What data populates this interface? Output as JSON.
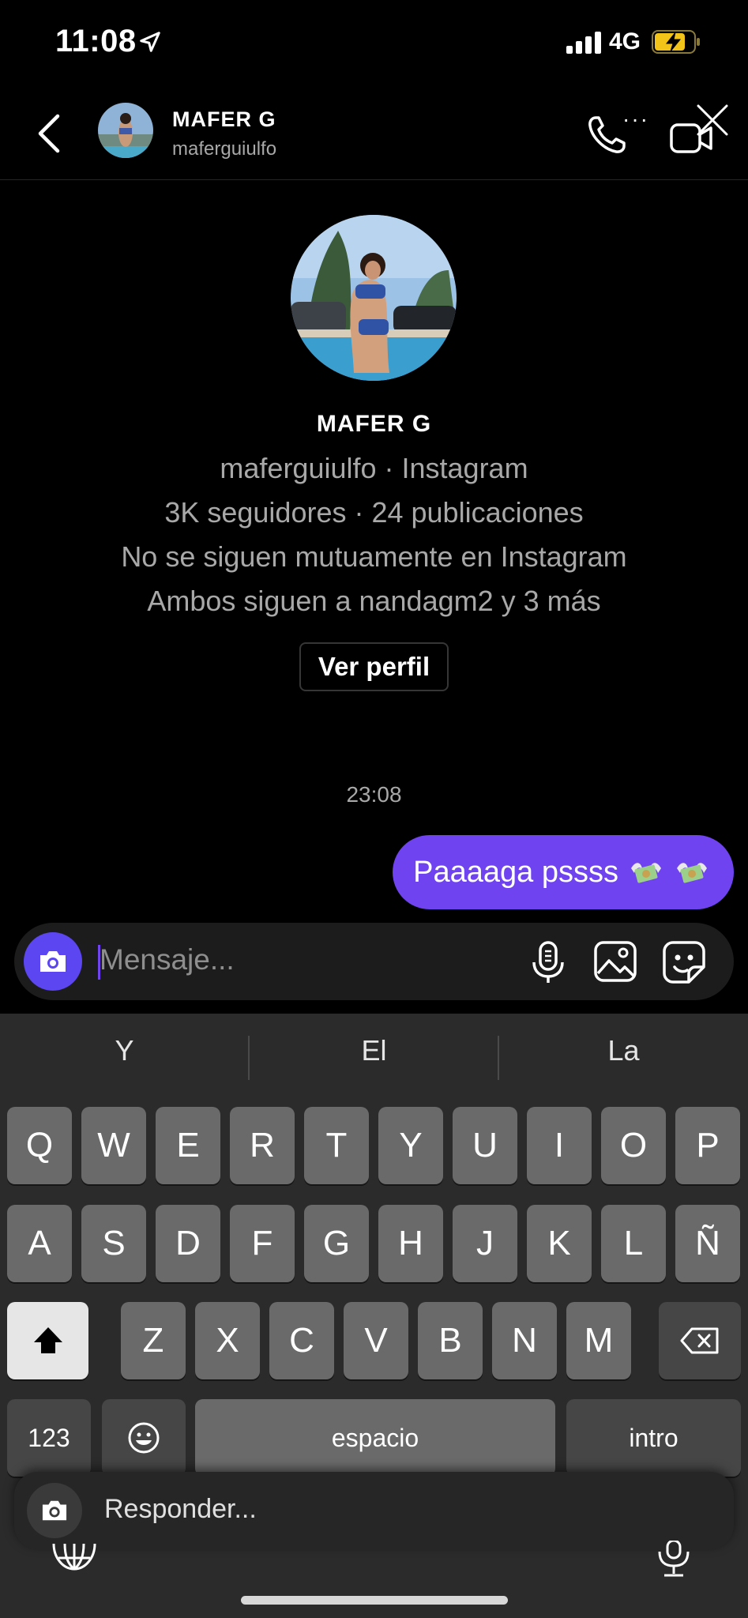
{
  "status_bar": {
    "time": "11:08",
    "network": "4G"
  },
  "header": {
    "name": "MAFER G",
    "username": "maferguiulfo",
    "more": "···"
  },
  "profile": {
    "name": "MAFER G",
    "line1": "maferguiulfo · Instagram",
    "line2": "3K seguidores · 24 publicaciones",
    "line3": "No se siguen mutuamente en Instagram",
    "line4": "Ambos siguen a nandagm2 y 3 más",
    "view_profile_label": "Ver perfil"
  },
  "conversation": {
    "timestamp": "23:08",
    "messages": [
      {
        "text": "Paaaaga pssss",
        "emoji": "money-with-wings",
        "sender": "me"
      }
    ]
  },
  "composer": {
    "placeholder": "Mensaje..."
  },
  "keyboard": {
    "suggestions": [
      "Y",
      "El",
      "La"
    ],
    "row1": [
      "Q",
      "W",
      "E",
      "R",
      "T",
      "Y",
      "U",
      "I",
      "O",
      "P"
    ],
    "row2": [
      "A",
      "S",
      "D",
      "F",
      "G",
      "H",
      "J",
      "K",
      "L",
      "Ñ"
    ],
    "row3": [
      "Z",
      "X",
      "C",
      "V",
      "B",
      "N",
      "M"
    ],
    "numbers_label": "123",
    "space_label": "espacio",
    "return_label": "intro"
  },
  "reply_bar": {
    "placeholder": "Responder..."
  },
  "colors": {
    "accent": "#6f43f0",
    "camera": "#5b46f2",
    "background": "#000000",
    "keyboard": "#2b2b2b"
  }
}
